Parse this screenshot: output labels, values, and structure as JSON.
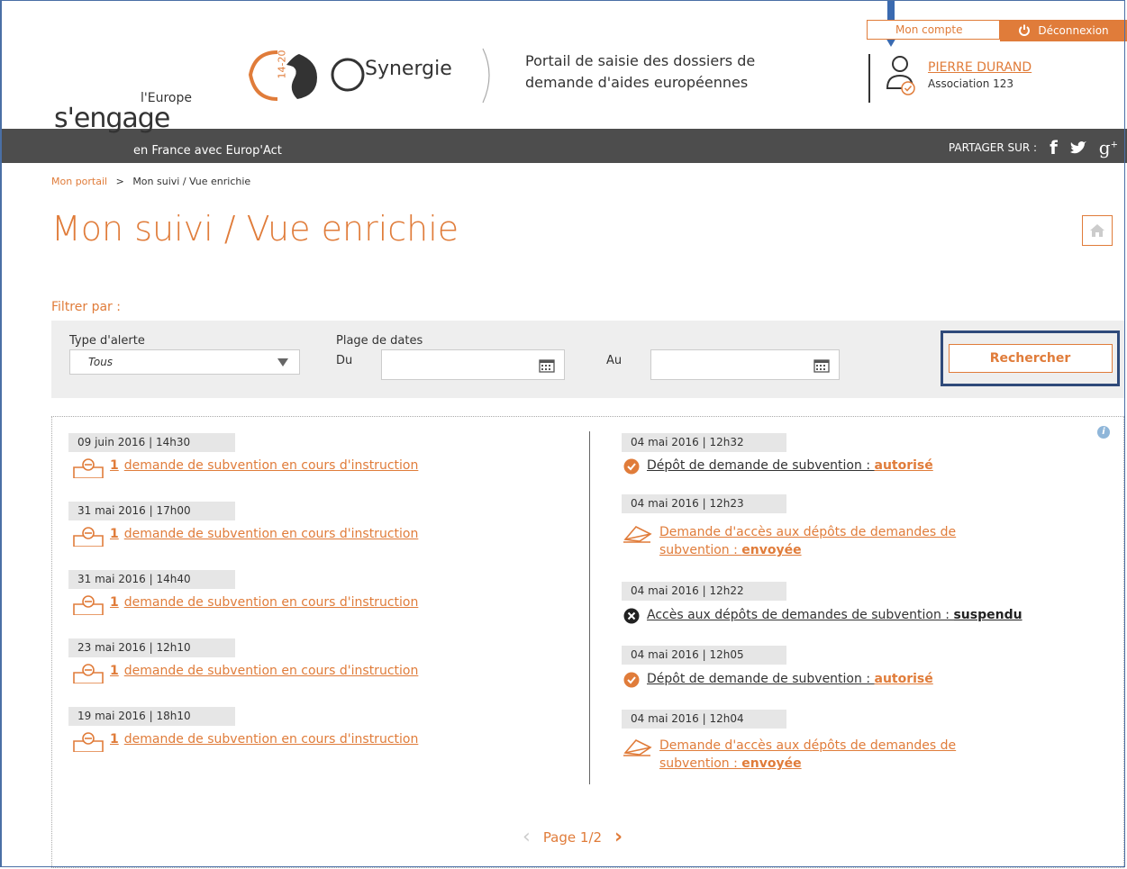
{
  "header": {
    "account_label": "Mon compte",
    "logout_label": "Déconnexion",
    "user_name": "PIERRE DURAND",
    "user_org": "Association 123",
    "europe_small": "l'Europe",
    "europe_big": "s'engage",
    "synergie_brand": "Synergie",
    "synergie_badge": "14-20",
    "portal_description_line1": "Portail de saisie des dossiers de",
    "portal_description_line2": "demande d'aides européennes",
    "subtitle": "en France avec Europ'Act",
    "share_label": "PARTAGER SUR :",
    "social": [
      "facebook-icon",
      "twitter-icon",
      "google-plus-icon"
    ]
  },
  "breadcrumb": {
    "home_link": "Mon portail",
    "separator": ">",
    "current": "Mon suivi / Vue enrichie"
  },
  "page": {
    "title": "Mon suivi / Vue enrichie"
  },
  "filters": {
    "heading": "Filtrer par :",
    "alert_type_label": "Type d'alerte",
    "alert_type_value": "Tous",
    "date_range_label": "Plage de dates",
    "from_label": "Du",
    "to_label": "Au",
    "from_value": "",
    "to_value": "",
    "search_label": "Rechercher"
  },
  "left_events": [
    {
      "date": "09 juin 2016 | 14h30",
      "count": "1",
      "text": "demande de subvention en cours d'instruction"
    },
    {
      "date": "31 mai 2016 | 17h00",
      "count": "1",
      "text": "demande de subvention en cours d'instruction"
    },
    {
      "date": "31 mai 2016 | 14h40",
      "count": "1",
      "text": "demande de subvention en cours d'instruction"
    },
    {
      "date": "23 mai 2016 | 12h10",
      "count": "1",
      "text": "demande de subvention en cours d'instruction"
    },
    {
      "date": "19 mai 2016 | 18h10",
      "count": "1",
      "text": "demande de subvention en cours d'instruction"
    }
  ],
  "right_events": [
    {
      "date": "04 mai 2016 | 12h32",
      "text": "Dépôt de demande de subvention : ",
      "status": "autorisé"
    },
    {
      "date": "04 mai 2016 | 12h23",
      "line1": "Demande d'accès aux dépôts de demandes de",
      "line2": "subvention : ",
      "status": "envoyée"
    },
    {
      "date": "04 mai 2016 | 12h22",
      "text": "Accès aux dépôts de demandes de subvention : ",
      "status": "suspendu"
    },
    {
      "date": "04 mai 2016 | 12h05",
      "text": "Dépôt de demande de subvention : ",
      "status": "autorisé"
    },
    {
      "date": "04 mai 2016 | 12h04",
      "line1": "Demande d'accès aux dépôts de demandes de",
      "line2": "subvention : ",
      "status": "envoyée"
    }
  ],
  "pagination": {
    "label": "Page 1/2"
  },
  "colors": {
    "accent": "#e07c3a",
    "bar": "#4d4d4d",
    "panel": "#eeeeee",
    "highlight": "#2f4a7a"
  }
}
